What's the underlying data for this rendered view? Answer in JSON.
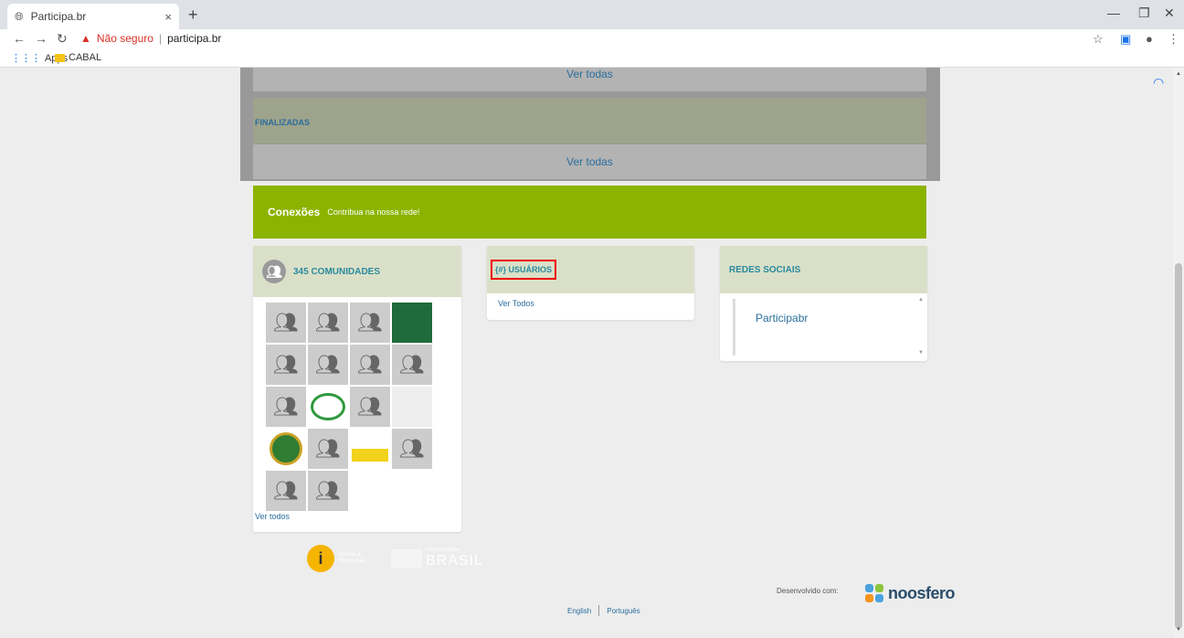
{
  "browser": {
    "tab_title": "Participa.br",
    "new_tab": "+",
    "url_warning": "Não seguro",
    "url_host": "participa.br",
    "bookmarks": [
      {
        "label": "Apps"
      },
      {
        "label": "CABAL"
      }
    ]
  },
  "page": {
    "ver_todas_top": "Ver todas",
    "finalizadas_label": "FINALIZADAS",
    "ver_todas_mid": "Ver todas",
    "banner": {
      "title": "Conexões",
      "subtitle": "Contribua na nossa rede!"
    },
    "communities": {
      "title": "345 COMUNIDADES",
      "ver_todos": "Ver todos"
    },
    "users": {
      "title": "{#} USUÁRIOS",
      "ver_todos": "Ver Todos"
    },
    "social": {
      "title": "REDES SOCIAIS",
      "link": "Participabr"
    },
    "footer": {
      "info_text": "Acesso à Informação",
      "brasil_small": "PÁTRIA AMADA",
      "brasil_big": "BRASIL",
      "developed_by": "Desenvolvido com:",
      "noosfero": "noosfero",
      "lang_en": "English",
      "lang_pt": "Português"
    }
  },
  "colors": {
    "banner_green": "#8cb300",
    "card_header": "#dae0c8",
    "link_blue": "#2a6e9e",
    "highlight_red": "#e00000"
  }
}
